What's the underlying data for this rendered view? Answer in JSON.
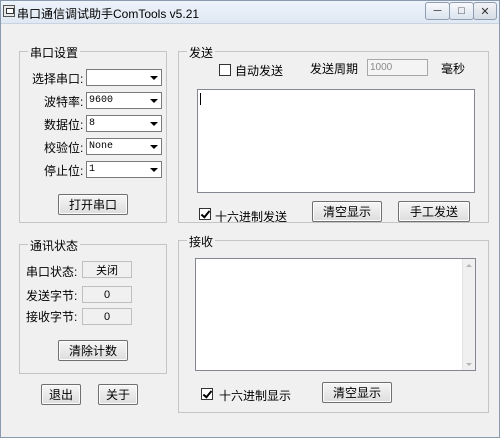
{
  "window": {
    "title": "串口通信调试助手ComTools v5.21",
    "min_glyph": "─",
    "max_glyph": "□",
    "close_glyph": "✕"
  },
  "serial_settings": {
    "group_title": "串口设置",
    "port_label": "选择串口:",
    "port_value": "",
    "baud_label": "波特率:",
    "baud_value": "9600",
    "databits_label": "数据位:",
    "databits_value": "8",
    "parity_label": "校验位:",
    "parity_value": "None",
    "stopbits_label": "停止位:",
    "stopbits_value": "1",
    "open_button": "打开串口"
  },
  "comm_status": {
    "group_title": "通讯状态",
    "port_status_label": "串口状态:",
    "port_status_value": "关闭",
    "sent_bytes_label": "发送字节:",
    "sent_bytes_value": "0",
    "recv_bytes_label": "接收字节:",
    "recv_bytes_value": "0",
    "clear_count_button": "清除计数"
  },
  "bottom_buttons": {
    "exit": "退出",
    "about": "关于"
  },
  "send": {
    "group_title": "发送",
    "auto_send_label": "自动发送",
    "auto_send_checked": false,
    "period_label": "发送周期",
    "period_value": "1000",
    "period_unit": "毫秒",
    "text": "",
    "hex_send_label": "十六进制发送",
    "hex_send_checked": true,
    "clear_button": "清空显示",
    "manual_send_button": "手工发送"
  },
  "receive": {
    "group_title": "接收",
    "text": "",
    "hex_display_label": "十六进制显示",
    "hex_display_checked": true,
    "clear_button": "清空显示"
  }
}
